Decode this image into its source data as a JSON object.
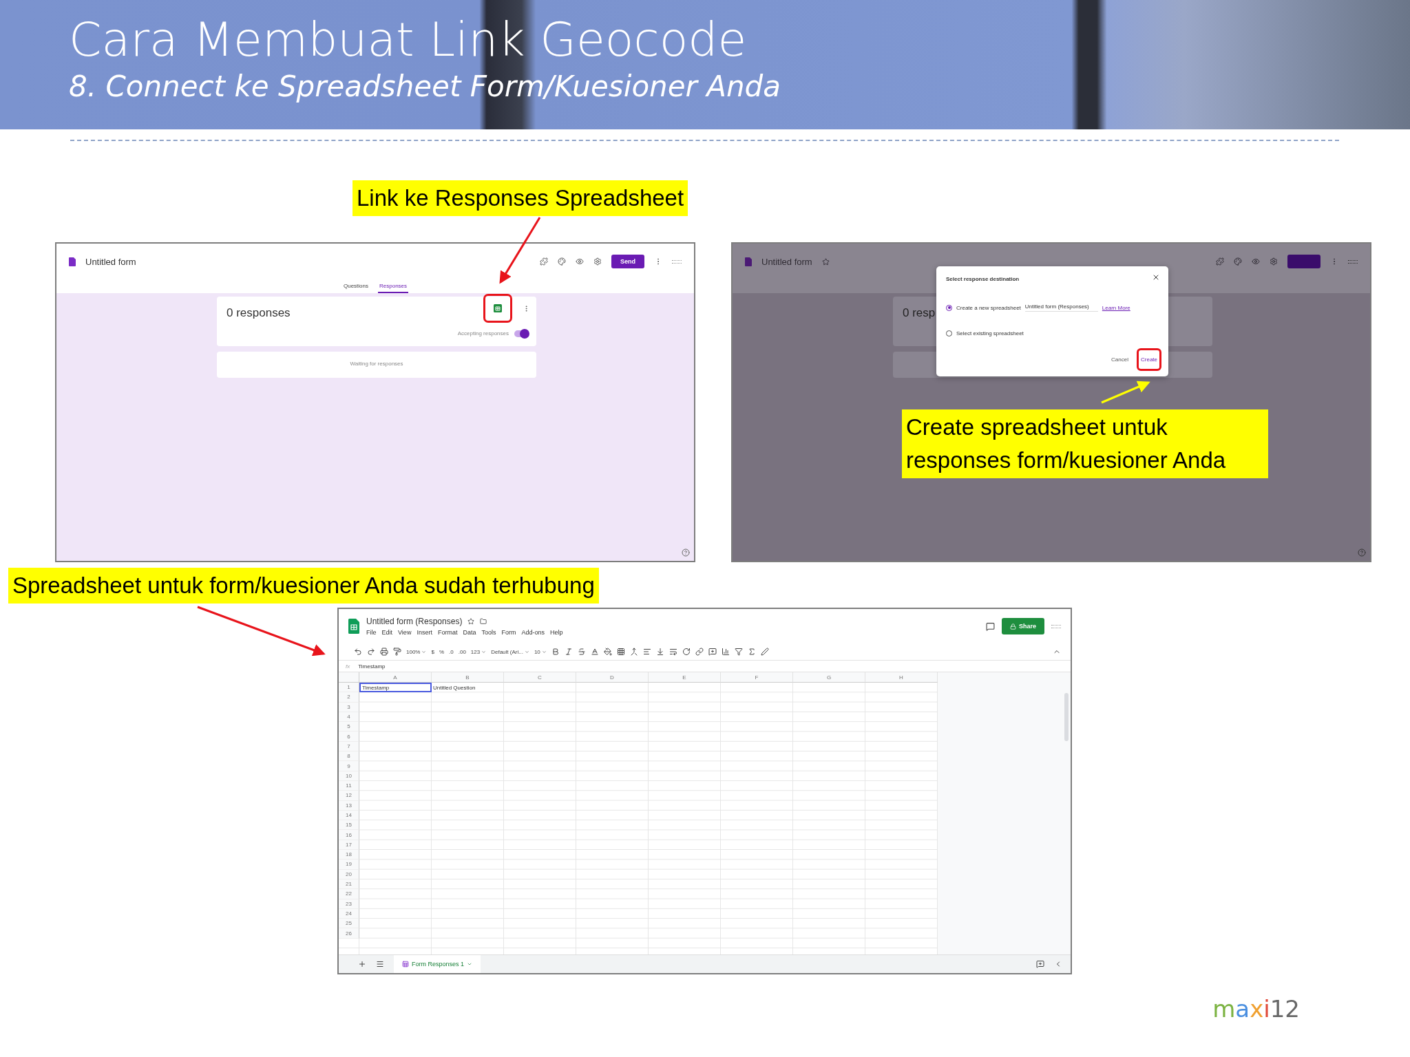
{
  "header": {
    "title": "Cara Membuat Link Geocode",
    "subtitle": "8. Connect ke Spreadsheet Form/Kuesioner Anda"
  },
  "callouts": [
    {
      "text": "Link ke Responses Spreadsheet"
    },
    {
      "text": "Create spreadsheet untuk responses form/kuesioner Anda"
    },
    {
      "text": "Spreadsheet untuk form/kuesioner Anda sudah terhubung"
    }
  ],
  "forms_screen": {
    "title": "Untitled form",
    "send_button": "Send",
    "tabs": [
      {
        "label": "Questions",
        "selected": false
      },
      {
        "label": "Responses",
        "selected": true
      }
    ],
    "responses_count": "0 responses",
    "accepting_label": "Accepting responses",
    "accepting_on": true,
    "waiting_text": "Waiting for responses"
  },
  "dialog_screen": {
    "title": "Untitled form",
    "responses_partial": "0 resp",
    "dialog": {
      "title": "Select response destination",
      "options": [
        {
          "label": "Create a new spreadsheet",
          "selected": true,
          "value": "Untitled form (Responses)",
          "link": "Learn More"
        },
        {
          "label": "Select existing spreadsheet",
          "selected": false
        }
      ],
      "cancel_button": "Cancel",
      "create_button": "Create"
    }
  },
  "sheet_screen": {
    "title": "Untitled form (Responses)",
    "menu": [
      "File",
      "Edit",
      "View",
      "Insert",
      "Format",
      "Data",
      "Tools",
      "Form",
      "Add-ons",
      "Help"
    ],
    "share_button": "Share",
    "toolbar": {
      "zoom": "100%",
      "currency": "$",
      "percent": "%",
      "decimals_less": ".0",
      "decimals_more": ".00",
      "number_format": "123",
      "font": "Default (Ari...",
      "font_size": "10"
    },
    "formula_label": "fx",
    "formula": "Timestamp",
    "columns": [
      "A",
      "B",
      "C",
      "D",
      "E",
      "F",
      "G",
      "H"
    ],
    "rows": [
      "1",
      "2",
      "3",
      "4",
      "5",
      "6",
      "7",
      "8",
      "9",
      "10",
      "11",
      "12",
      "13",
      "14",
      "15",
      "16",
      "17",
      "18",
      "19",
      "20",
      "21",
      "22",
      "23",
      "24",
      "25",
      "26"
    ],
    "cells": [
      "Timestamp",
      "Untitled Question"
    ],
    "sheet_tab": "Form Responses 1"
  },
  "logo": {
    "letters": [
      {
        "char": "m",
        "color": "#7cb342"
      },
      {
        "char": "a",
        "color": "#4a8fe0"
      },
      {
        "char": "x",
        "color": "#f0a030"
      },
      {
        "char": "i",
        "color": "#e04a3a"
      }
    ],
    "number": "12"
  }
}
